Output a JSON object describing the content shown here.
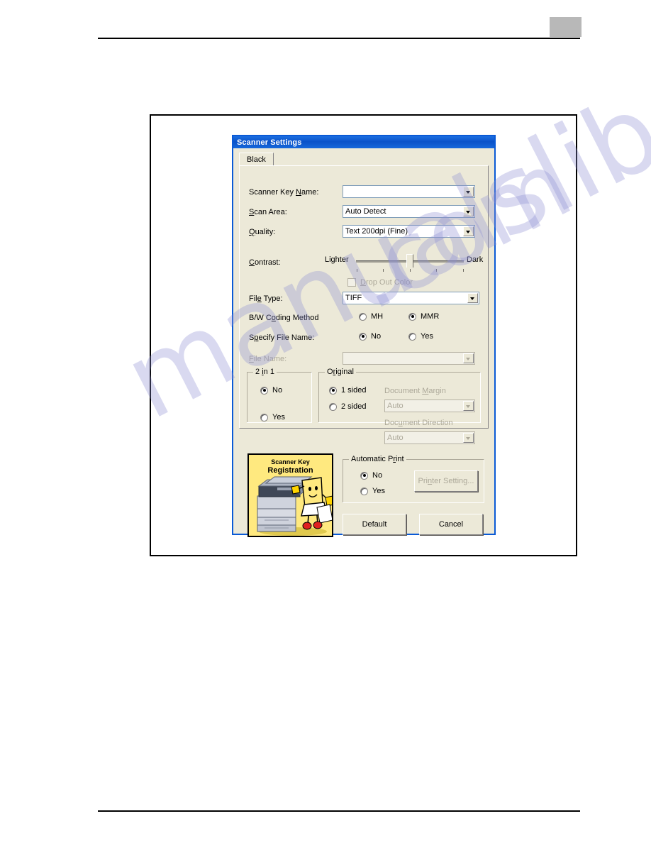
{
  "page": {
    "header_mark": "gray-block",
    "header_rule": true,
    "footer_rule": true
  },
  "watermark": {
    "line_a": "manualslib",
    "line_b": ".com"
  },
  "dialog": {
    "title": "Scanner Settings",
    "tabs": [
      {
        "label": "Black",
        "active": true
      }
    ],
    "fields": {
      "scanner_key_name": {
        "label": "Scanner Key N",
        "label_accel": "N",
        "label_pre": "Scanner Key ",
        "label_post": "ame:",
        "value": "",
        "type": "combobox"
      },
      "scan_area": {
        "label_pre": "",
        "label_accel": "S",
        "label_post": "can Area:",
        "value": "Auto Detect",
        "type": "combobox"
      },
      "quality": {
        "label_pre": "",
        "label_accel": "Q",
        "label_post": "uality:",
        "value": "Text 200dpi (Fine)",
        "type": "combobox"
      },
      "contrast": {
        "label_pre": "",
        "label_accel": "C",
        "label_post": "ontrast:",
        "min_label": "Lighter",
        "max_label": "Dark",
        "ticks": 5,
        "position": 3
      },
      "drop_out_color": {
        "label_pre": "",
        "label_accel": "D",
        "label_post": "rop Out Color",
        "checked": false,
        "enabled": false
      },
      "file_type": {
        "label_pre": "Fil",
        "label_accel": "e",
        "label_post": " Type:",
        "value": "TIFF",
        "type": "combobox"
      },
      "bw_coding_method": {
        "label_pre": "B/W C",
        "label_accel": "o",
        "label_post": "ding Method",
        "options": [
          "MH",
          "MMR"
        ],
        "selected": "MMR"
      },
      "specify_file_name": {
        "label_pre": "S",
        "label_accel": "p",
        "label_post": "ecify File Name:",
        "options": [
          "No",
          "Yes"
        ],
        "selected": "No"
      },
      "file_name": {
        "label_pre": "",
        "label_accel": "F",
        "label_post": "ile Name:",
        "value": "",
        "enabled": false,
        "type": "combobox"
      }
    },
    "groups": {
      "two_in_one": {
        "title_pre": "2 ",
        "title_accel": "i",
        "title_post": "n 1",
        "options": [
          "No",
          "Yes"
        ],
        "selected": "No"
      },
      "original": {
        "title_pre": "O",
        "title_accel": "r",
        "title_post": "iginal",
        "options": [
          "1 sided",
          "2 sided"
        ],
        "selected": "1 sided",
        "document_margin": {
          "label_pre": "Document ",
          "label_accel": "M",
          "label_post": "argin",
          "value": "Auto",
          "enabled": false
        },
        "document_direction": {
          "label_pre": "Doc",
          "label_accel": "u",
          "label_post": "ment Direction",
          "value": "Auto",
          "enabled": false
        }
      },
      "automatic_print": {
        "title_pre": "Automatic P",
        "title_accel": "r",
        "title_post": "int",
        "options": [
          "No",
          "Yes"
        ],
        "selected": "No",
        "printer_setting_button": {
          "label_pre": "Pri",
          "label_accel": "n",
          "label_post": "ter Setting...",
          "enabled": false
        }
      }
    },
    "illustration": {
      "title_line1": "Scanner Key",
      "title_line2": "Registration",
      "name": "scanner-key-registration-image"
    },
    "buttons": {
      "default": "Default",
      "cancel": "Cancel"
    }
  }
}
